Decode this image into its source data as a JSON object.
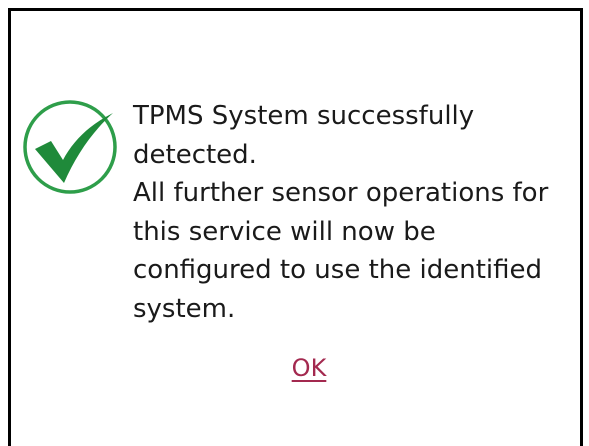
{
  "dialog": {
    "icon": "checkmark-circle-icon",
    "message_lines": [
      "TPMS System successfully",
      "detected.",
      "All further sensor operations for",
      "this service will now be",
      "configured to use the identified",
      "system."
    ],
    "ok_label": "OK"
  },
  "colors": {
    "check_ring": "#2e9e4a",
    "check_mark": "#1f8a3a",
    "link": "#a3294f",
    "border": "#000000",
    "text": "#1a1a1a"
  }
}
